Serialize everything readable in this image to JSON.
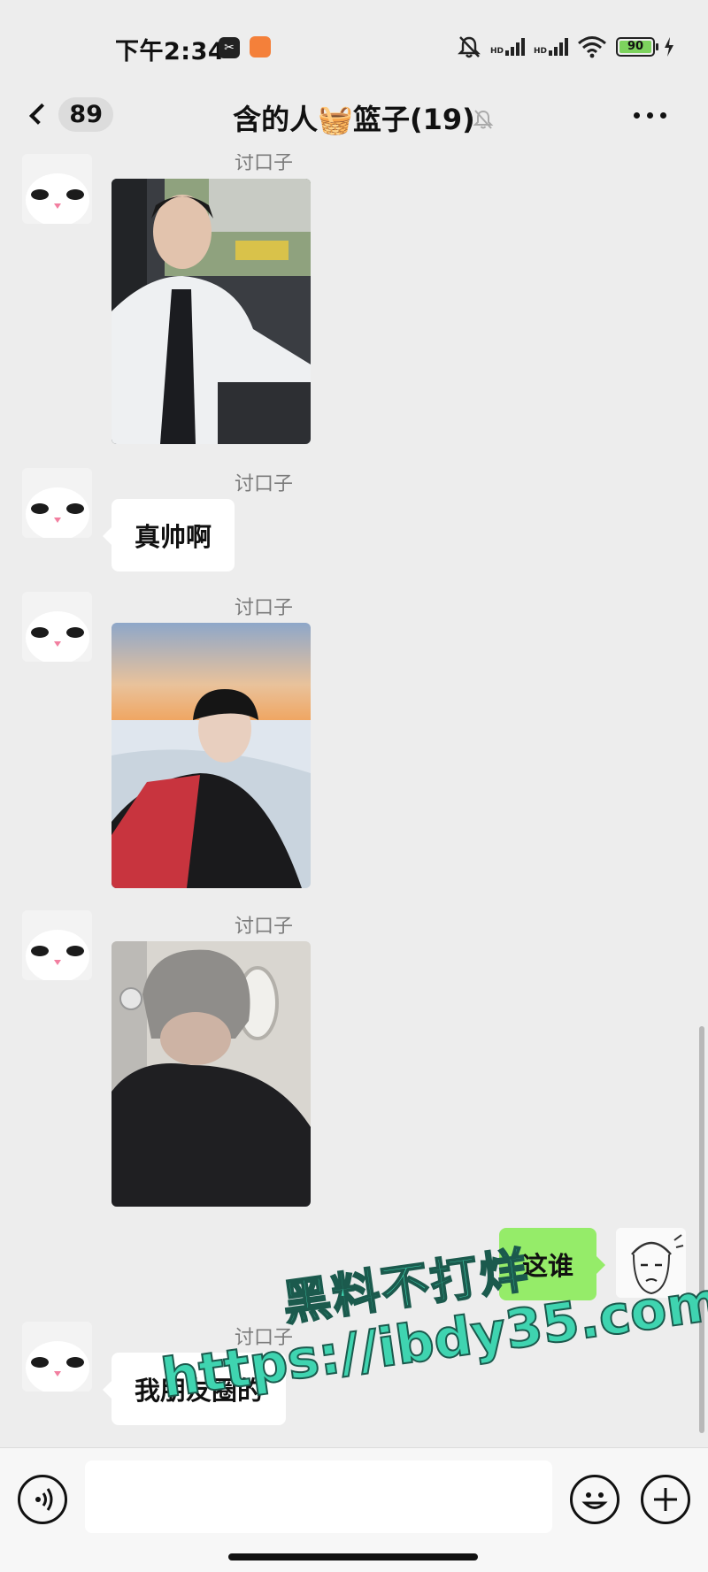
{
  "status_bar": {
    "time": "下午2:34",
    "battery": "90",
    "icons": [
      "capcut-icon",
      "app-icon",
      "mute-bell-icon",
      "signal-hd-icon",
      "signal-hd-icon",
      "wifi-icon",
      "battery-icon",
      "charging-icon"
    ]
  },
  "header": {
    "unread_count": "89",
    "title": "含的人🧺篮子(19)",
    "icons": [
      "back-chevron-icon",
      "mute-icon",
      "more-icon"
    ]
  },
  "messages": [
    {
      "sender": "讨口子",
      "type": "image",
      "avatar": "white-cat-avatar",
      "image_desc": "young man in white shirt and tie seated in car"
    },
    {
      "sender": "讨口子",
      "type": "text",
      "text": "真帅啊",
      "avatar": "white-cat-avatar"
    },
    {
      "sender": "讨口子",
      "type": "image",
      "avatar": "white-cat-avatar",
      "image_desc": "man in black beanie and red shirt by snowy shore at sunset"
    },
    {
      "sender": "讨口子",
      "type": "image",
      "avatar": "white-cat-avatar",
      "image_desc": "man in gray beanie and black coat by airplane window"
    },
    {
      "sender": "me",
      "type": "text",
      "text": "这谁",
      "avatar": "sketch-man-avatar"
    },
    {
      "sender": "讨口子",
      "type": "text",
      "text": "我朋友圈的",
      "avatar": "white-cat-avatar"
    }
  ],
  "watermark": {
    "line1": "黑料不打烊",
    "line2": "https://ibdy35.com"
  },
  "input_bar": {
    "icons": [
      "voice-icon",
      "emoji-icon",
      "plus-icon"
    ]
  },
  "colors": {
    "background": "#ededed",
    "my_bubble": "#95ec69",
    "other_bubble": "#ffffff",
    "watermark": "#3fd4b0"
  }
}
